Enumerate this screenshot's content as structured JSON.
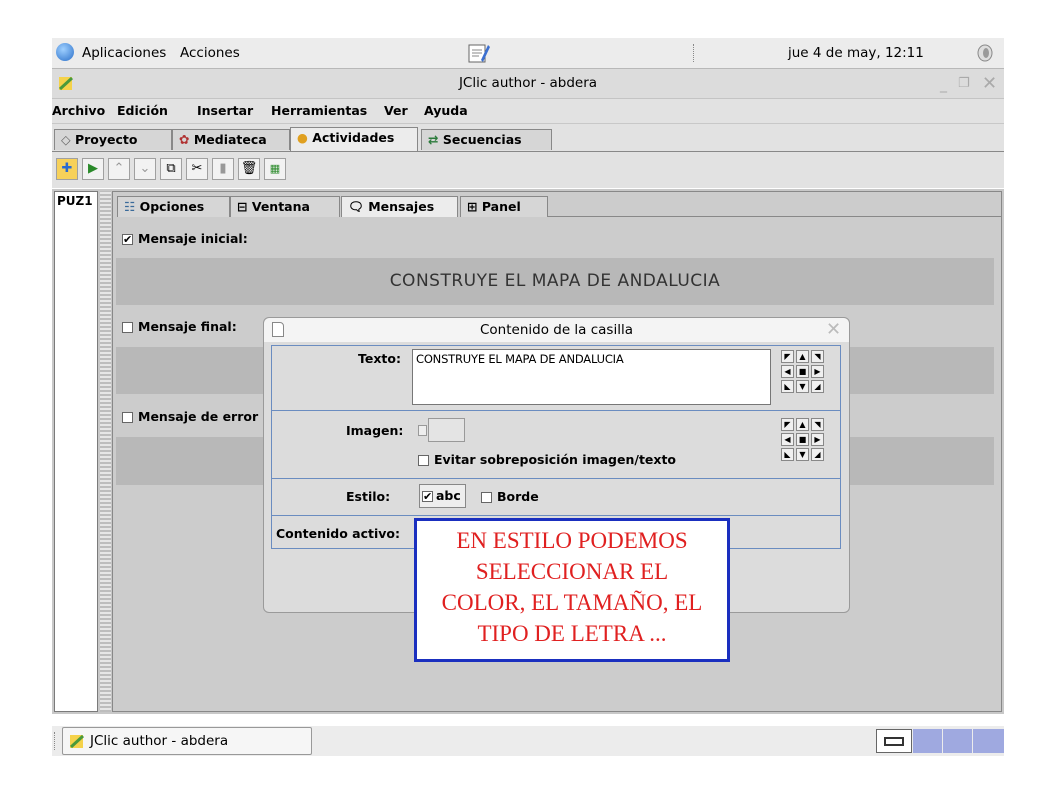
{
  "top_panel": {
    "applications": "Aplicaciones",
    "actions": "Acciones",
    "clock": "jue  4 de may, 12:11"
  },
  "window": {
    "title": "JClic author - abdera"
  },
  "menubar": [
    "Archivo",
    "Edición",
    "Insertar",
    "Herramientas",
    "Ver",
    "Ayuda"
  ],
  "main_tabs": [
    "Proyecto",
    "Mediateca",
    "Actividades",
    "Secuencias"
  ],
  "activity_list": [
    "PUZ1"
  ],
  "sub_tabs": [
    "Opciones",
    "Ventana",
    "Mensajes",
    "Panel"
  ],
  "messages": {
    "initial_label": "Mensaje inicial:",
    "initial_text": "CONSTRUYE EL MAPA DE ANDALUCIA",
    "final_label": "Mensaje final:",
    "error_label": "Mensaje de error"
  },
  "dialog": {
    "title": "Contenido de la casilla",
    "text_label": "Texto:",
    "text_value": "CONSTRUYE EL MAPA DE ANDALUCIA",
    "image_label": "Imagen:",
    "avoid_overlap": "Evitar sobreposición imagen/texto",
    "style_label": "Estilo:",
    "style_button": "abc",
    "border_label": "Borde",
    "active_content_label": "Contenido activo:"
  },
  "taskbar": {
    "task": "JClic author - abdera"
  },
  "annotation": {
    "lines": [
      "EN ESTILO PODEMOS",
      "SELECCIONAR EL",
      "COLOR, EL TAMAÑO, EL",
      "TIPO DE LETRA ..."
    ]
  },
  "colors": {
    "annotation_border": "#1a2fbf",
    "annotation_text": "#e02020",
    "separator_blue": "#6a8cc0"
  }
}
